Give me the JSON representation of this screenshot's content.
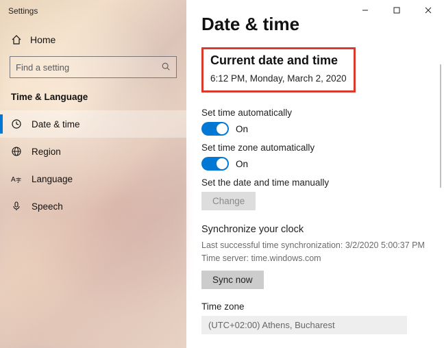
{
  "window": {
    "title": "Settings"
  },
  "sidebar": {
    "home": "Home",
    "search_placeholder": "Find a setting",
    "category": "Time & Language",
    "items": [
      {
        "label": "Date & time"
      },
      {
        "label": "Region"
      },
      {
        "label": "Language"
      },
      {
        "label": "Speech"
      }
    ]
  },
  "content": {
    "page_title": "Date & time",
    "current": {
      "heading": "Current date and time",
      "value": "6:12 PM, Monday, March 2, 2020"
    },
    "toggles": [
      {
        "label": "Set time automatically",
        "state": "On"
      },
      {
        "label": "Set time zone automatically",
        "state": "On"
      }
    ],
    "manual": {
      "label": "Set the date and time manually",
      "button": "Change"
    },
    "sync": {
      "heading": "Synchronize your clock",
      "last": "Last successful time synchronization: 3/2/2020 5:00:37 PM",
      "server": "Time server: time.windows.com",
      "button": "Sync now"
    },
    "timezone": {
      "heading": "Time zone",
      "value": "(UTC+02:00) Athens, Bucharest"
    }
  }
}
